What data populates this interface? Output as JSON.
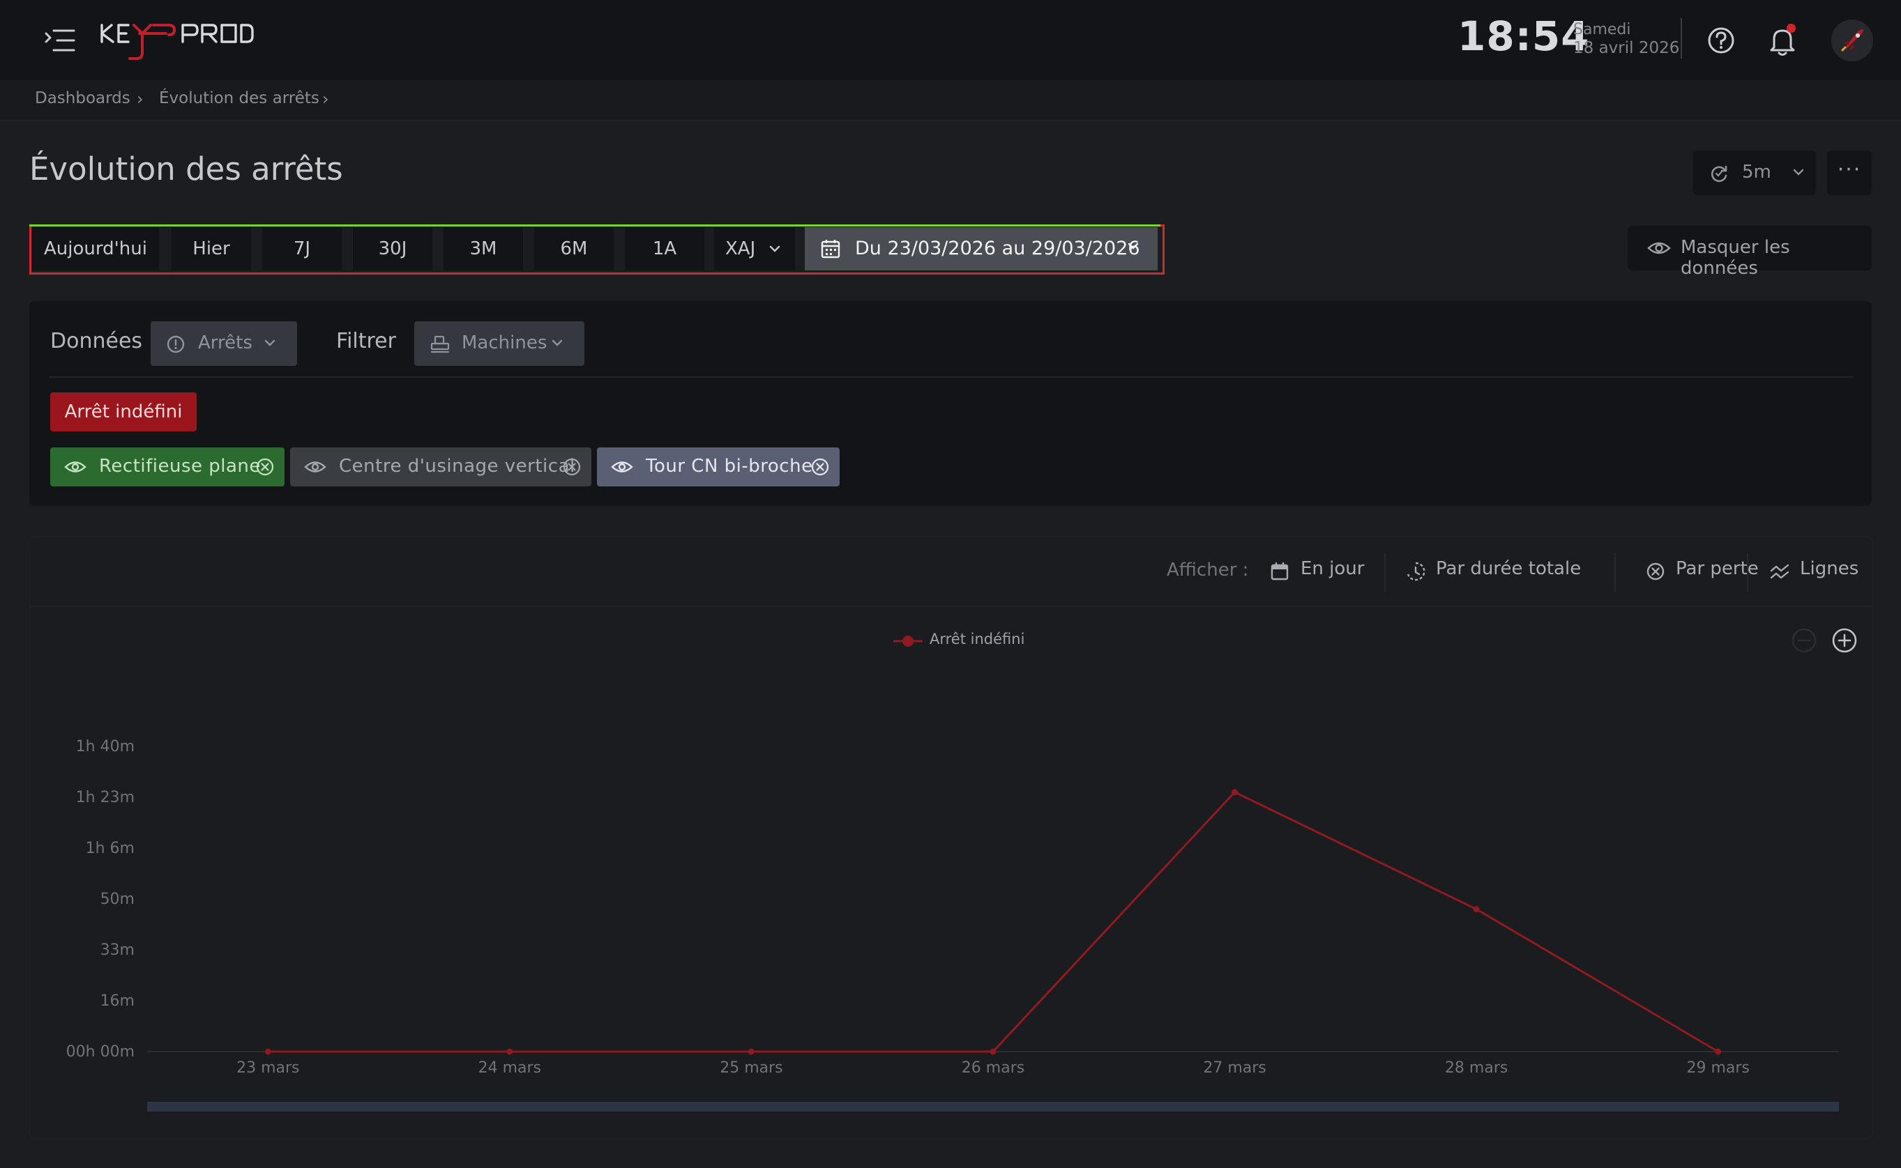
{
  "header": {
    "logo_text": "KEYPROD",
    "clock": "18:54",
    "day": "Samedi",
    "date": "18 avril 2026"
  },
  "breadcrumb": [
    "Dashboards",
    "Évolution des arrêts"
  ],
  "page": {
    "title": "Évolution des arrêts",
    "refresh_interval": "5m",
    "hide_data_label": "Masquer les données"
  },
  "range": {
    "buttons": [
      "Aujourd'hui",
      "Hier",
      "7J",
      "30J",
      "3M",
      "6M",
      "1A"
    ],
    "xaj_label": "XAJ",
    "date_range_label": "Du 23/03/2026 au 29/03/2026"
  },
  "filters": {
    "data_label": "Données",
    "data_value": "Arrêts",
    "filter_label": "Filtrer",
    "filter_value": "Machines",
    "stop_tag": "Arrêt indéfini",
    "machines": [
      {
        "label": "Rectifieuse plane",
        "bg": "#2b6b2f",
        "color": "#c8e3c4"
      },
      {
        "label": "Centre d'usinage vertical",
        "bg": "#3a3d42",
        "color": "#a5a9b0"
      },
      {
        "label": "Tour CN bi-broche",
        "bg": "#5b5f74",
        "color": "#e6e7ee"
      }
    ]
  },
  "display": {
    "label": "Afficher :",
    "options": [
      "En jour",
      "Par durée totale",
      "Par perte",
      "Lignes"
    ]
  },
  "chart_data": {
    "type": "line",
    "series": [
      {
        "name": "Arrêt indéfini",
        "color": "#8f1a20",
        "values": [
          0,
          0,
          0,
          0,
          5100,
          2800,
          0
        ]
      }
    ],
    "categories": [
      "23 mars",
      "24 mars",
      "25 mars",
      "26 mars",
      "27 mars",
      "28 mars",
      "29 mars"
    ],
    "y_ticks": [
      {
        "value": 0,
        "label": "00h 00m"
      },
      {
        "value": 1000,
        "label": "16m"
      },
      {
        "value": 2000,
        "label": "33m"
      },
      {
        "value": 3000,
        "label": "50m"
      },
      {
        "value": 4000,
        "label": "1h 6m"
      },
      {
        "value": 5000,
        "label": "1h 23m"
      },
      {
        "value": 6000,
        "label": "1h 40m"
      }
    ],
    "ylim": [
      0,
      6000
    ],
    "legend_position": "top-center",
    "grid": false
  },
  "colors": {
    "accent_red": "#9a161c",
    "line_red": "#8f1a20",
    "background": "#1b1d20",
    "panel": "#131417"
  }
}
